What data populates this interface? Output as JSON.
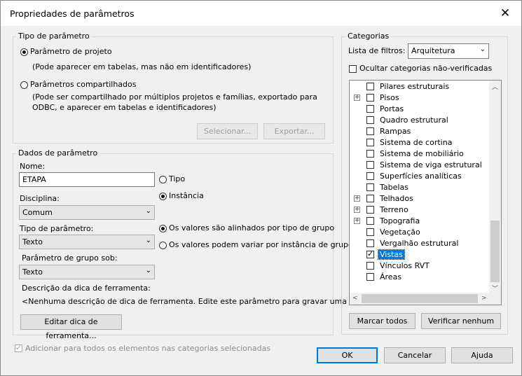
{
  "window": {
    "title": "Propriedades de parâmetros",
    "close_glyph": "✕"
  },
  "tipo": {
    "group_label": "Tipo de parâmetro",
    "projeto_label": "Parâmetro de projeto",
    "projeto_desc": "(Pode aparecer em tabelas, mas não em identificadores)",
    "compartilhado_label": "Parâmetros compartilhados",
    "compartilhado_desc_1": "(Pode ser compartilhado por múltiplos projetos e famílias, exportado para",
    "compartilhado_desc_2": "ODBC, e aparecer em tabelas e identificadores)",
    "selecionar_label": "Selecionar...",
    "exportar_label": "Exportar..."
  },
  "dados": {
    "group_label": "Dados de parâmetro",
    "nome_label": "Nome:",
    "nome_value": "ETAPA",
    "tipo_radio": "Tipo",
    "instancia_radio": "Instância",
    "disciplina_label": "Disciplina:",
    "disciplina_value": "Comum",
    "tipo_param_label": "Tipo de parâmetro:",
    "tipo_param_value": "Texto",
    "alinhados_radio": "Os valores são alinhados por tipo de grupo",
    "variar_radio": "Os valores podem variar por instância de grupo",
    "grupo_label": "Parâmetro de grupo sob:",
    "grupo_value": "Texto",
    "dica_label": "Descrição da dica de ferramenta:",
    "dica_value": "<Nenhuma descrição de dica de ferramenta. Edite este parâmetro para gravar uma dica d...",
    "editar_dica_label": "Editar dica de ferramenta..."
  },
  "adicionar_label": "Adicionar para todos os elementos nas categorias selecionadas",
  "categorias": {
    "group_label": "Categorias",
    "filtro_label": "Lista de filtros:",
    "filtro_value": "Arquitetura",
    "ocultar_label": "Ocultar categorias não-verificadas",
    "items": [
      {
        "label": "Pilares estruturais",
        "expand": false,
        "checked": false
      },
      {
        "label": "Pisos",
        "expand": true,
        "checked": false
      },
      {
        "label": "Portas",
        "expand": false,
        "checked": false
      },
      {
        "label": "Quadro estrutural",
        "expand": false,
        "checked": false
      },
      {
        "label": "Rampas",
        "expand": false,
        "checked": false
      },
      {
        "label": "Sistema de cortina",
        "expand": false,
        "checked": false
      },
      {
        "label": "Sistema de mobiliário",
        "expand": false,
        "checked": false
      },
      {
        "label": "Sistema de viga estrutural",
        "expand": false,
        "checked": false
      },
      {
        "label": "Superfícies analíticas",
        "expand": false,
        "checked": false
      },
      {
        "label": "Tabelas",
        "expand": false,
        "checked": false
      },
      {
        "label": "Telhados",
        "expand": true,
        "checked": false
      },
      {
        "label": "Terreno",
        "expand": true,
        "checked": false
      },
      {
        "label": "Topografia",
        "expand": true,
        "checked": false
      },
      {
        "label": "Vegetação",
        "expand": false,
        "checked": false
      },
      {
        "label": "Vergalhão estrutural",
        "expand": false,
        "checked": false
      },
      {
        "label": "Vistas",
        "expand": false,
        "checked": true,
        "selected": true
      },
      {
        "label": "Vínculos RVT",
        "expand": false,
        "checked": false
      },
      {
        "label": "Áreas",
        "expand": false,
        "checked": false
      }
    ],
    "marcar_label": "Marcar todos",
    "verificar_label": "Verificar nenhum"
  },
  "footer": {
    "ok_label": "OK",
    "cancelar_label": "Cancelar",
    "ajuda_label": "Ajuda"
  },
  "icons": {
    "dropdown": "chevron-down-icon",
    "close": "close-icon",
    "expand": "plus-icon"
  }
}
